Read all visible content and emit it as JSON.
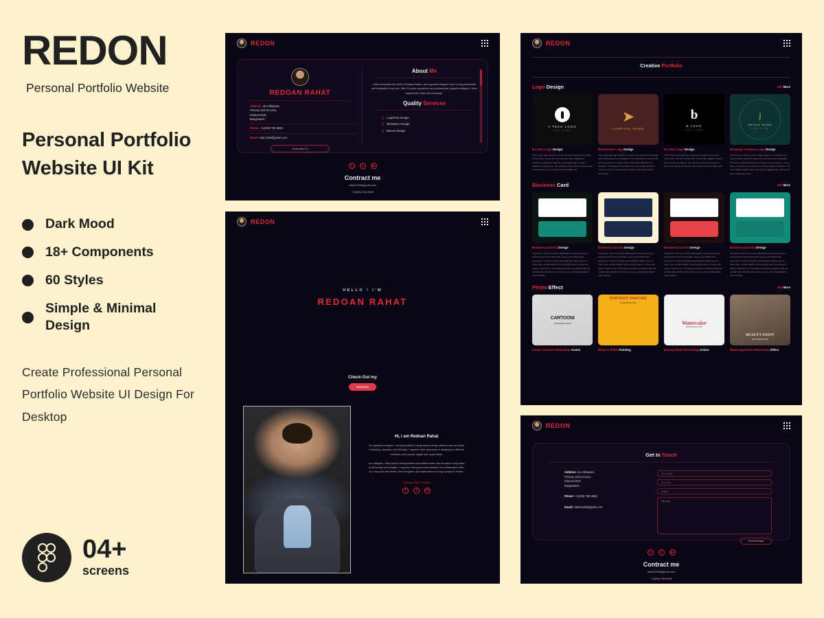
{
  "left_panel": {
    "brand": "REDON",
    "brand_sub": "Personal Portfolio Website",
    "kit_title": "Personal Portfolio Website UI Kit",
    "features": [
      "Dark Mood",
      "18+ Components",
      "60 Styles",
      "Simple & Minimal Design"
    ],
    "description": "Create Professional Personal Portfolio Website UI Design For Desktop",
    "figma": {
      "icon": "figma-icon",
      "count": "04+",
      "word": "screens"
    }
  },
  "colors": {
    "page_bg": "#FCF3CE",
    "ink": "#1F1F1F",
    "accent_red": "#E02B3C",
    "screen_bg": "#0B0614",
    "card_bg": "#100A1C"
  },
  "screen_about": {
    "logo": "REDON",
    "menu_icon": "grid-menu-icon",
    "name": "REDOAN RAHAT",
    "address_label": "Address:",
    "address_value": "4no Milapara,",
    "address_line2": "Primary School Lane,",
    "address_line3": "Khulna-9100,",
    "address_line4": "Bangladesh.",
    "phone_label": "Phone:",
    "phone_value": "+1(408) 785-9559",
    "email_label": "Email:",
    "email_value": "mail 2345@gmail.com",
    "cv_button": "Download CV",
    "about_title": "About ",
    "about_title_accent": "Me",
    "about_text": "Hello everybody! My name is Redoan Rahat. I am a graphic designer, and I'm very passionate and dedicated to my work. With 10 years experience as a professional a graphic designer, I have acquired the skills and knowledge.",
    "quality_title": "Quality ",
    "quality_title_accent": "Services",
    "services": [
      "Logo/Icon Design",
      "Illustration Design",
      "Banner Design"
    ],
    "socials": [
      "f",
      "t",
      "in"
    ],
    "footer_title": "Contract me",
    "footer_mail": "mail12345@gmail.com",
    "footer_phone": "+1(408) 785-9559"
  },
  "screen_hero": {
    "logo": "REDON",
    "menu_icon": "grid-menu-icon",
    "hello": "HELLO !  I'M",
    "name": "REDOAN RAHAT",
    "checkout_label": "Check-Out my",
    "checkout_button": "Services",
    "bio_title": "Hi, I am Redoan Rahat",
    "bio_p1": "As a graphics designer, I am likely skilled in using various design software such as Adobe Photoshop, Illustrator, and InDesign. I may also have experience in designing for different mediums, such as print, digital, and social media.",
    "bio_p2": "As a designer, I likely have a strong creative and artistic sense, and am able to bring ideas to life through your designs. I may also have good communication and collaboration skills, as I may work with clients, other designers, and stakeholders to bring a project to fruition.",
    "bio_link": "Checkout My Portfolio",
    "socials": [
      "f",
      "t",
      "in"
    ],
    "photo_alt": "portrait-photo"
  },
  "screen_portfolio": {
    "logo": "REDON",
    "menu_icon": "grid-menu-icon",
    "page_title": "Creative ",
    "page_title_accent": "Portfolio",
    "sections": [
      {
        "title_accent": "Logo",
        "title": " Design",
        "see_more_accent": "See ",
        "see_more": "More",
        "cards": [
          {
            "caption_accent": "B Letter Logo ",
            "caption": "Design",
            "body": "This b letter logo features a bold and clean design with a slight tilt to convey movement. The open left side suggests an entrance or gateway, while the closed right side provides stability and protection. The gradient of blue tones creates depth and dimension for a modern and minimalist look.",
            "mark_name": "A TECH LOGO",
            "mark_tag": "TAG LINE",
            "bg": "#0d0d0d",
            "mark": "headphone-mark"
          },
          {
            "caption_accent": "Real-Estate Logo ",
            "caption": "Design",
            "body": "This real estate logo features a modern and professional design with a strong focus on typography. The typography's clean, bold and sans-serif font is also used for the trademark text and reliability. The design incorporates an iconic image such as a house or a roof to represent the industry and create brand recognition.",
            "mark_name": "COMPANI NAME",
            "mark_tag": "",
            "bg": "#4a2020",
            "mark": "bird-mark"
          },
          {
            "caption_accent": "H Letter Logo ",
            "caption": "Design",
            "body": "This H letter logo features a sleek and modern design with clean lines. The two vertical lines of the H are slightly curved to add a touch of elegance. The typeface used for the letter is sans-serif, giving the logo a contemporary and minimalist look.",
            "mark_name": "B LOGO",
            "mark_tag": "TAG LINE",
            "bg": "#000000",
            "mark": "b-letter-mark"
          },
          {
            "caption_accent": "Housing Company Logo ",
            "caption": "Design",
            "body": "This housing company logo design features a minimalist and contemporary look with clean lines and sans-serif typography. The logo incorporates an iconic image such as a house, roof or door to represent the industry and create brand recognition. The color palette used is warm and inviting, suggesting a welcoming and comfortable home.",
            "mark_name": "BRAND NAME",
            "mark_tag": "TAG LINE",
            "bg": "#0d3330",
            "mark": "j-ring-mark"
          }
        ]
      },
      {
        "title_accent": "Business",
        "title": " Card",
        "see_more_accent": "See ",
        "see_more": "More",
        "cards": [
          {
            "caption_accent": "Business Card 02 ",
            "caption": "Design",
            "body": "A business card is a crucial marketing tool that represents a professional's brand and helps make a memorable first impression. It should include essential information such as name, title, contact details, and company logo in a neat and easy to read format. The design should be consistent with the overall brand identity and convey a sense of professionalism and creativity.",
            "bg": "#0a1512",
            "card_top": "#ffffff",
            "card_bottom": "#148b7a"
          },
          {
            "caption_accent": "Business Card 01 ",
            "caption": "Design",
            "body": "A business card is a crucial marketing tool that represents a professional's brand and helps make a memorable first impression. It should include essential information such as name, title, contact details, and company logo in a clear and easy to read format. The design should be consistent with the overall brand identity and convey a sense of professionalism and creativity.",
            "bg": "#fbf1d4",
            "card_top": "#1b2a4a",
            "card_bottom": "#1b2a4a"
          },
          {
            "caption_accent": "Business Card 04 ",
            "caption": "Design",
            "body": "A business card is a crucial marketing tool that represents a professional's brand and helps make a memorable first impression. It should include essential information such as name, title, contact details, and company logo in a clear and easy to read format. The design should be consistent with the overall brand identity and convey a sense of professionalism and creativity.",
            "bg": "#1d0f0f",
            "card_top": "#ffffff",
            "card_bottom": "#e8434a"
          },
          {
            "caption_accent": "Business Card 03 ",
            "caption": "Design",
            "body": "A business card is a crucial marketing tool that represents a professional's brand and helps make a memorable first impression. It should include essential information such as name, title, contact details, and company logo in a neat and easy to read format. The design should be consistent with the overall brand identity and convey a sense of professionalism and creativity.",
            "bg": "#148b7a",
            "card_top": "#ffffff",
            "card_bottom": "#0f7e6e"
          }
        ]
      },
      {
        "title_accent": "Photo",
        "title": " Effect",
        "see_more_accent": "See ",
        "see_more": "More",
        "cards": [
          {
            "caption_accent": "Comic Cartoon Photoshop ",
            "caption": "Action",
            "label": "CARTOONI",
            "sub": "PHOTOSHOP ACTION",
            "bg": "#e8e8e6"
          },
          {
            "caption_accent": "Black & White ",
            "caption": "Painting",
            "label": "PORTRAIT PAINTING",
            "sub": "PHOTOSHOP ACTION",
            "bg": "#f5b019"
          },
          {
            "caption_accent": "Beauty Paint Photoshop ",
            "caption": "Action",
            "label": "Watercolor",
            "sub": "PHOTOSHOP ACTION",
            "bg": "#f2f2f0"
          },
          {
            "caption_accent": "Blaze Explosion Photoshop ",
            "caption": "Effect",
            "label": "BEAUTY PAINT",
            "sub": "PHOTOSHOP ACTION",
            "bg": "#6b5a4c"
          }
        ]
      }
    ]
  },
  "screen_contact": {
    "logo": "REDON",
    "menu_icon": "grid-menu-icon",
    "title": "Get In ",
    "title_accent": "Touch",
    "address_label": "Address:",
    "address_value": "4no Milapara,",
    "address_line2": "Primary School Lane,",
    "address_line3": "Khulna-9100,",
    "address_line4": "Bangladesh.",
    "phone_label": "Phone:",
    "phone_value": "+1(408) 785-9559",
    "email_label": "Email:",
    "email_value": "mail12345@gmail.com",
    "fields": {
      "name": "Your Name",
      "mail": "Your Mail",
      "subject": "Subject",
      "message": "Message"
    },
    "send_button": "Send Message",
    "socials": [
      "f",
      "t",
      "in"
    ],
    "footer_title": "Contract me",
    "footer_mail": "mail12345@gmail.com",
    "footer_phone": "+1(408) 785-9559"
  }
}
